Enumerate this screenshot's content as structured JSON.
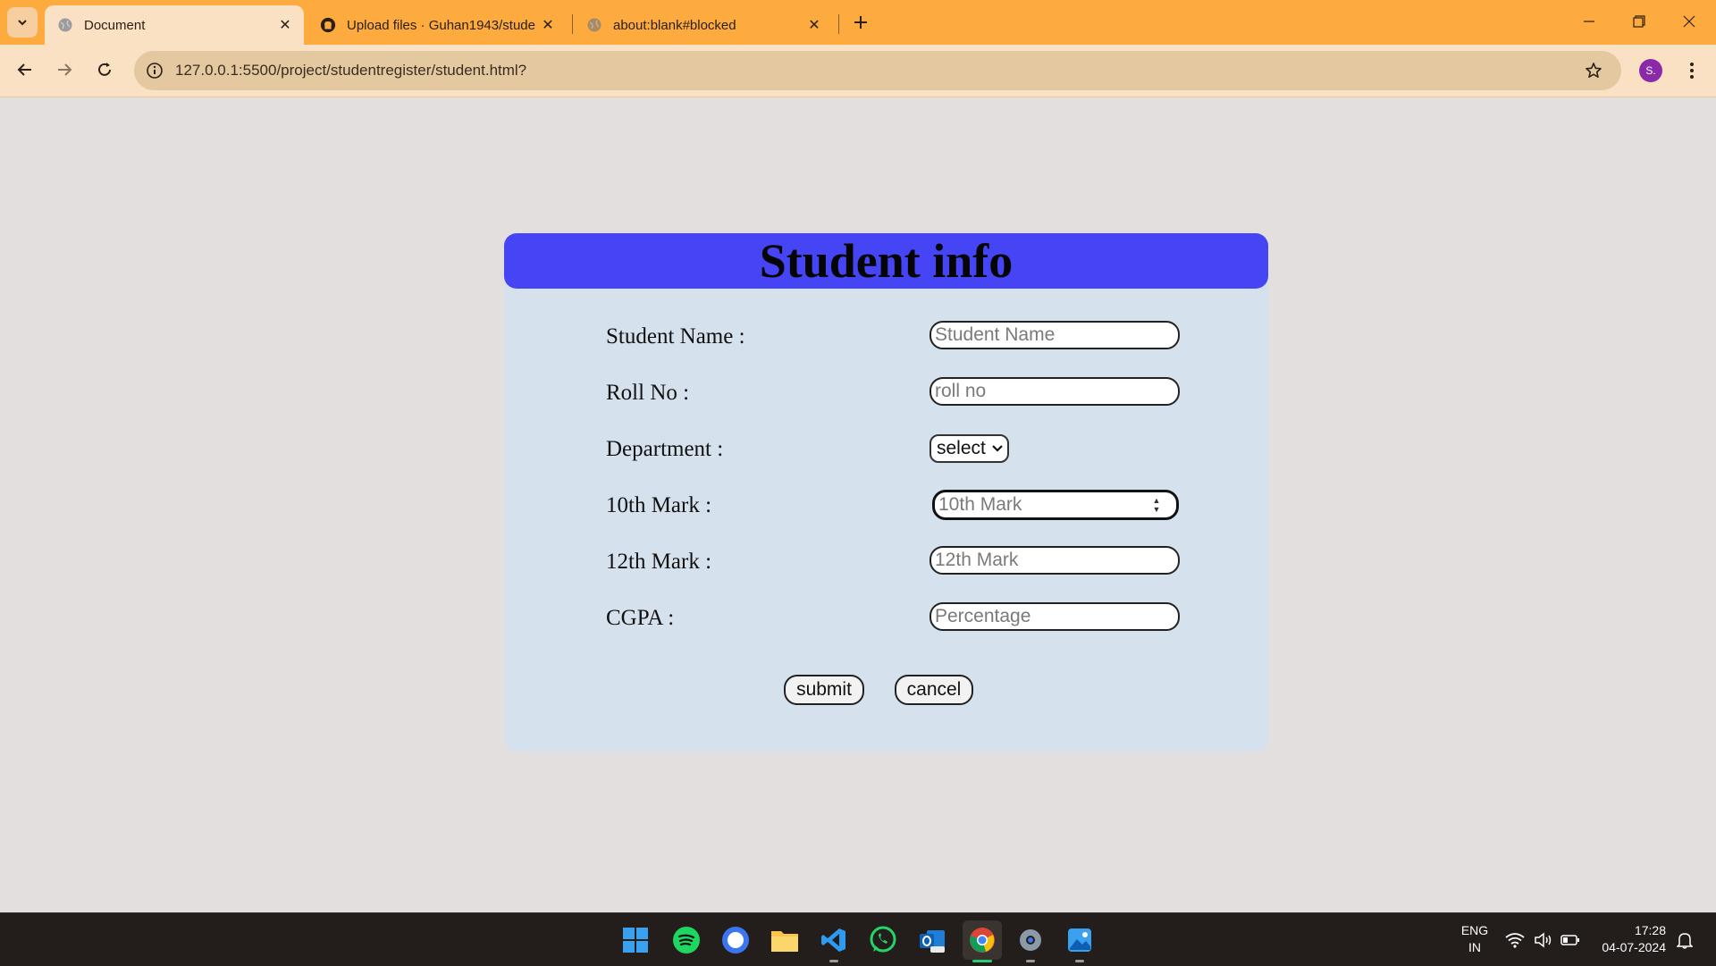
{
  "browser": {
    "tabs": [
      {
        "title": "Document",
        "active": true
      },
      {
        "title": "Upload files · Guhan1943/stude",
        "active": false
      },
      {
        "title": "about:blank#blocked",
        "active": false
      }
    ],
    "url": "127.0.0.1:5500/project/studentregister/student.html?",
    "profile_initial": "S."
  },
  "form": {
    "title": "Student info",
    "fields": [
      {
        "label": "Student Name :",
        "placeholder": "Student Name"
      },
      {
        "label": "Roll No :",
        "placeholder": "roll no"
      },
      {
        "label": "Department :",
        "selected": "select"
      },
      {
        "label": "10th Mark :",
        "placeholder": "10th Mark"
      },
      {
        "label": "12th Mark :",
        "placeholder": "12th Mark"
      },
      {
        "label": "CGPA :",
        "placeholder": "Percentage"
      }
    ],
    "submit_label": "submit",
    "cancel_label": "cancel"
  },
  "taskbar": {
    "apps": [
      "windows-start-icon",
      "spotify-icon",
      "signal-icon",
      "file-explorer-icon",
      "vscode-icon",
      "whatsapp-icon",
      "outlook-icon",
      "chrome-icon",
      "settings-icon",
      "photos-icon"
    ],
    "language_line1": "ENG",
    "language_line2": "IN",
    "time": "17:28",
    "date": "04-07-2024"
  },
  "colors": {
    "tabstrip": "#fdab3e",
    "toolbar": "#fbe1c4",
    "form_header": "#4545f6",
    "form_body": "#d6e1ee"
  }
}
